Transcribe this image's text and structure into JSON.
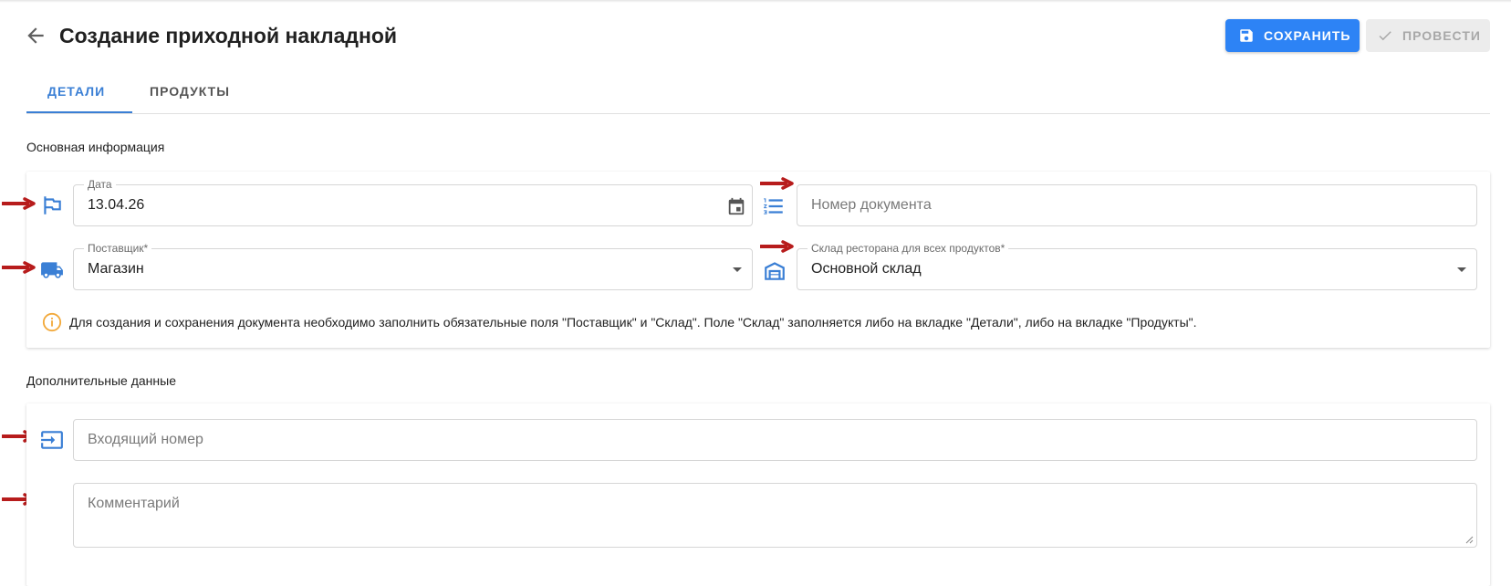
{
  "header": {
    "title": "Создание приходной накладной",
    "save_label": "СОХРАНИТЬ",
    "post_label": "ПРОВЕСТИ"
  },
  "tabs": [
    {
      "label": "ДЕТАЛИ",
      "active": true
    },
    {
      "label": "ПРОДУКТЫ",
      "active": false
    }
  ],
  "main_info": {
    "title": "Основная информация",
    "date": {
      "label": "Дата",
      "value": "13.04.26"
    },
    "doc_number": {
      "placeholder": "Номер документа"
    },
    "supplier": {
      "label": "Поставщик*",
      "value": "Магазин"
    },
    "warehouse": {
      "label": "Склад ресторана для всех продуктов*",
      "value": "Основной склад"
    },
    "notice": "Для создания и сохранения документа необходимо заполнить обязательные поля \"Поставщик\" и \"Склад\". Поле \"Склад\" заполняется либо на вкладке \"Детали\", либо на вкладке \"Продукты\"."
  },
  "extra": {
    "title": "Дополнительные данные",
    "incoming_number": {
      "placeholder": "Входящий номер"
    },
    "comment": {
      "placeholder": "Комментарий"
    }
  },
  "colors": {
    "accent": "#2d83f5",
    "icon": "#3a7fd5",
    "annotation_arrow": "#b71c1c",
    "warning": "#f2a93b"
  }
}
